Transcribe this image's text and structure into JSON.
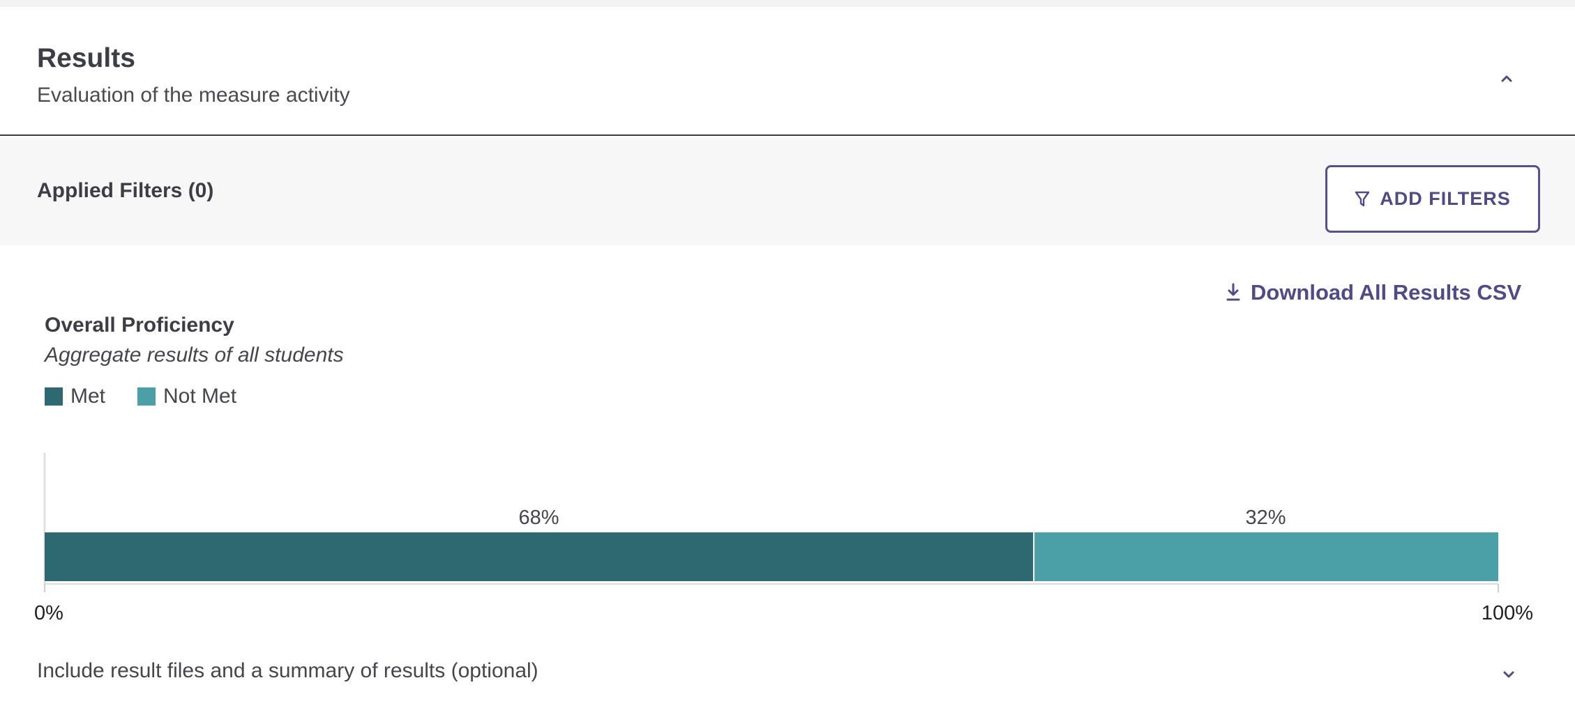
{
  "header": {
    "title": "Results",
    "subtitle": "Evaluation of the measure activity",
    "collapse_icon": "chevron-up-icon"
  },
  "filters": {
    "label": "Applied Filters (0)",
    "add_button_label": "ADD FILTERS",
    "add_button_icon": "filter-icon"
  },
  "download": {
    "label": "Download All Results CSV",
    "icon": "download-icon"
  },
  "colors": {
    "met": "#2e6870",
    "not_met": "#4b9fa6",
    "accent": "#4f4a88"
  },
  "chart_data": {
    "type": "bar",
    "stacked": true,
    "orientation": "horizontal",
    "title": "Overall Proficiency",
    "subtitle": "Aggregate results of all students",
    "legend_position": "top-left",
    "series": [
      {
        "name": "Met",
        "values": [
          68
        ],
        "label": "68%"
      },
      {
        "name": "Not Met",
        "values": [
          32
        ],
        "label": "32%"
      }
    ],
    "xlim": [
      0,
      100
    ],
    "x_ticks": [
      "0%",
      "100%"
    ]
  },
  "footer": {
    "label": "Include result files and a summary of results (optional)",
    "expand_icon": "chevron-down-icon"
  }
}
